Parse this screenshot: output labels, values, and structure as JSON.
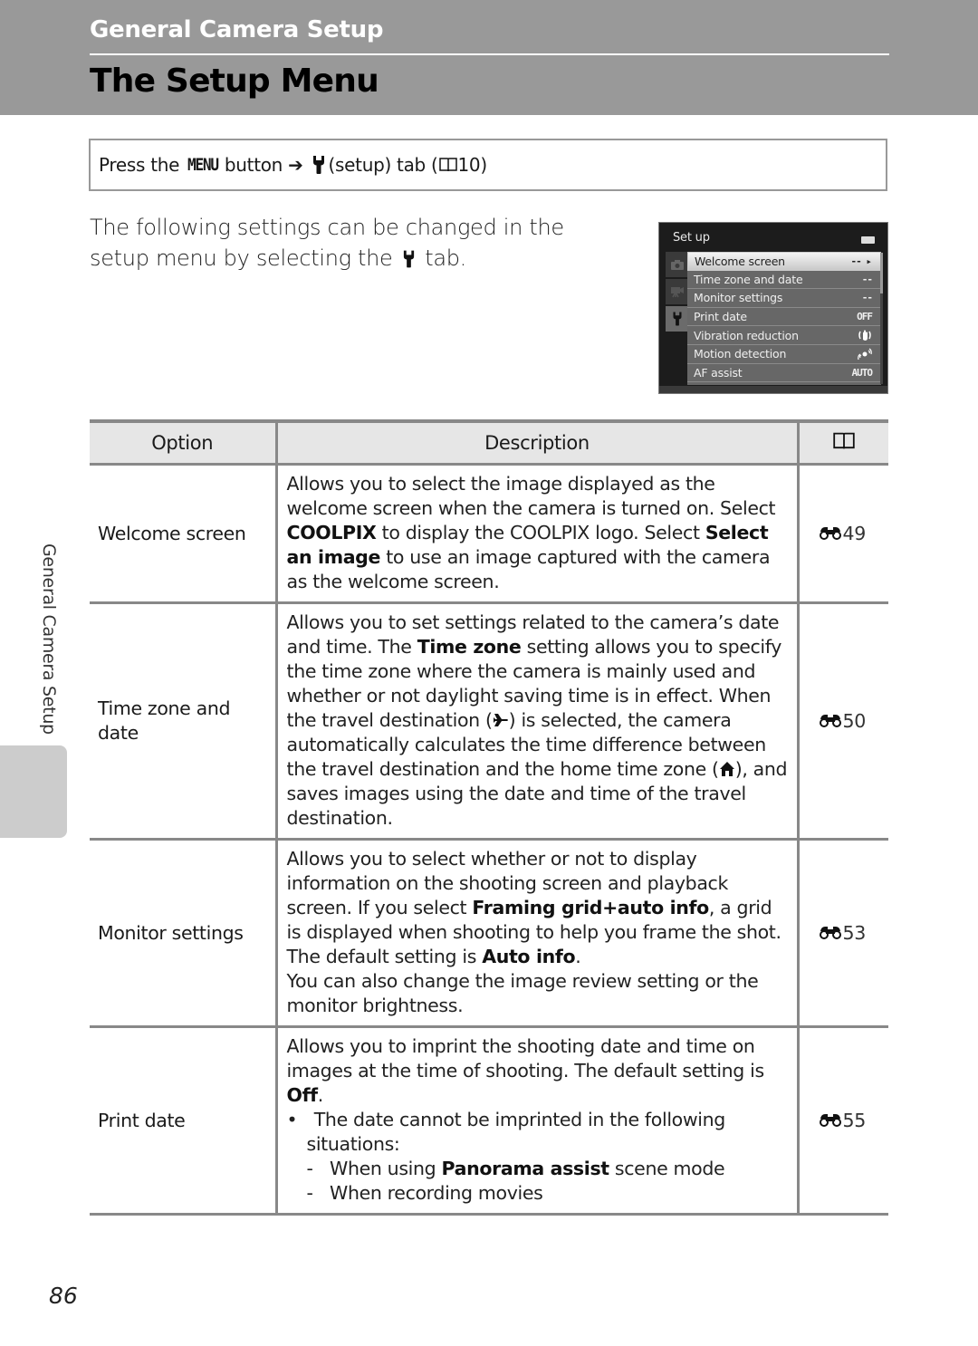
{
  "header": {
    "section": "General Camera Setup",
    "title": "The Setup Menu"
  },
  "nav": {
    "prefix": "Press the",
    "menu_word": "MENU",
    "button": "button",
    "arrow": "➔",
    "tab_text": "(setup) tab (",
    "page_ref": "10)"
  },
  "intro": {
    "line1": "The following settings can be changed in the setup menu by selecting the",
    "line2": "tab."
  },
  "camera_screen": {
    "title": "Set up",
    "items": [
      {
        "label": "Welcome screen",
        "value": "-- ▸",
        "selected": true
      },
      {
        "label": "Time zone and date",
        "value": "--"
      },
      {
        "label": "Monitor settings",
        "value": "--"
      },
      {
        "label": "Print date",
        "value": "OFF"
      },
      {
        "label": "Vibration reduction",
        "value": "vr-icon"
      },
      {
        "label": "Motion detection",
        "value": "motion-icon"
      },
      {
        "label": "AF assist",
        "value": "AUTO"
      }
    ]
  },
  "table": {
    "headers": [
      "Option",
      "Description",
      "book-icon"
    ],
    "rows": [
      {
        "option": "Welcome screen",
        "desc": {
          "t1": "Allows you to select the image displayed as the welcome screen when the camera is turned on. Select ",
          "b1": "COOLPIX",
          "t2": " to display the COOLPIX logo. Select ",
          "b2": "Select an image",
          "t3": " to use an image captured with the camera as the welcome screen."
        },
        "ref": "49"
      },
      {
        "option": "Time zone and date",
        "desc": {
          "t1": "Allows you to set settings related to the camera’s date and time. The ",
          "b1": "Time zone",
          "t2": " setting allows you to specify the time zone where the camera is mainly used and whether or not daylight saving time is in effect. When the travel destination (",
          "t3": ") is selected, the camera automatically calculates the time difference between the travel destination and the home time zone (",
          "t4": "), and saves images using the date and time of the travel destination."
        },
        "ref": "50"
      },
      {
        "option": "Monitor settings",
        "desc": {
          "t1": "Allows you to select whether or not to display information on the shooting screen and playback screen. If you select ",
          "b1": "Framing grid+auto info",
          "t2": ", a grid is displayed when shooting to help you frame the shot. The default setting is ",
          "b2": "Auto info",
          "t3": ".",
          "t4": "You can also change the image review setting or the monitor brightness."
        },
        "ref": "53"
      },
      {
        "option": "Print date",
        "desc": {
          "t1": "Allows you to imprint the shooting date and time on images at the time of shooting. The default setting is ",
          "b1": "Off",
          "t2": ".",
          "bullet": "The date cannot be imprinted in the following situations:",
          "dash1_a": "When using ",
          "dash1_b": "Panorama assist",
          "dash1_c": " scene mode",
          "dash2": "When recording movies"
        },
        "ref": "55"
      }
    ]
  },
  "side_label": "General Camera Setup",
  "page_number": "86"
}
